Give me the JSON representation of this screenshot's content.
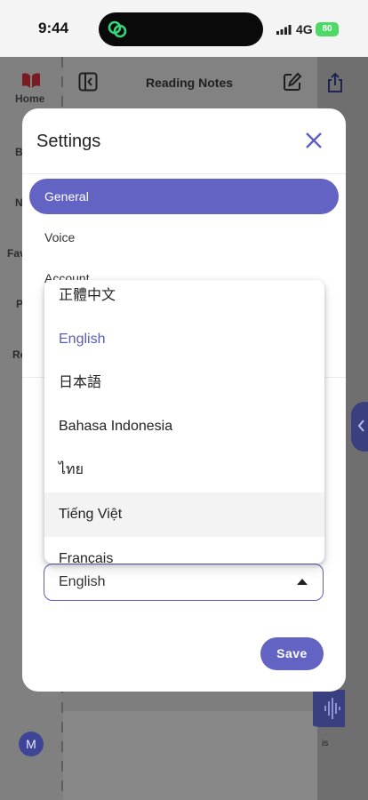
{
  "status_bar": {
    "time": "9:44",
    "network": "4G",
    "battery": "80"
  },
  "background": {
    "sidebar": {
      "home_label": "Home",
      "fragments": [
        "B",
        "N",
        "Fav",
        "P",
        "Re"
      ]
    },
    "header_title": "Reading Notes",
    "voice_label": "is",
    "avatar_initial": "M"
  },
  "settings_dialog": {
    "title": "Settings",
    "nav": [
      {
        "label": "General",
        "active": true
      },
      {
        "label": "Voice",
        "active": false
      },
      {
        "label": "Account",
        "active": false
      }
    ],
    "language_select": {
      "value": "English"
    },
    "save_label": "Save"
  },
  "language_menu": {
    "options": [
      {
        "label": "正體中文",
        "selected": false
      },
      {
        "label": "English",
        "selected": true
      },
      {
        "label": "日本語",
        "selected": false
      },
      {
        "label": "Bahasa Indonesia",
        "selected": false
      },
      {
        "label": "ไทย",
        "selected": false
      },
      {
        "label": "Tiếng Việt",
        "selected": false
      },
      {
        "label": "Français",
        "selected": false
      }
    ]
  },
  "colors": {
    "accent": "#6363c4",
    "selected_text": "#5a5db8",
    "scrim": "#7e7e7e"
  }
}
